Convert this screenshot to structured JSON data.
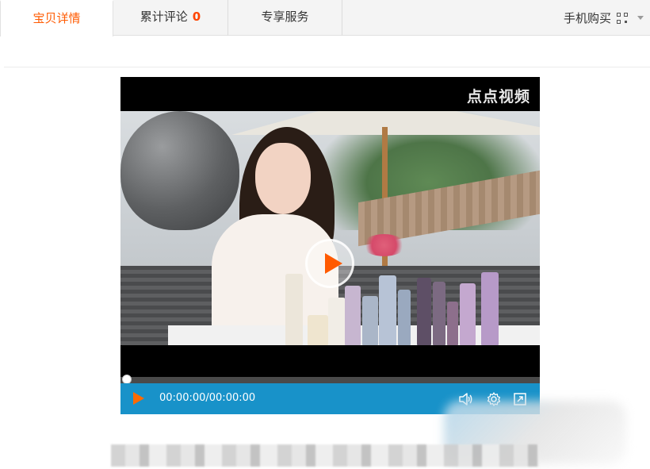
{
  "tabs": [
    {
      "label": "宝贝详情",
      "active": true
    },
    {
      "label": "累计评论",
      "count": "0"
    },
    {
      "label": "专享服务"
    }
  ],
  "mobile_buy": {
    "label": "手机购买",
    "icon": "qr-code-icon",
    "dropdown_icon": "caret-down-icon"
  },
  "player": {
    "brand": "点点视频",
    "time": "00:00:00/00:00:00",
    "progress": 0,
    "controls": {
      "play_icon": "play-icon",
      "volume_icon": "volume-icon",
      "settings_icon": "gear-icon",
      "fullscreen_icon": "fullscreen-icon"
    }
  },
  "colors": {
    "accent": "#ff5a00",
    "count": "#ff4400",
    "controls_bar": "#1892c9",
    "tab_bar": "#f4f4f4"
  }
}
